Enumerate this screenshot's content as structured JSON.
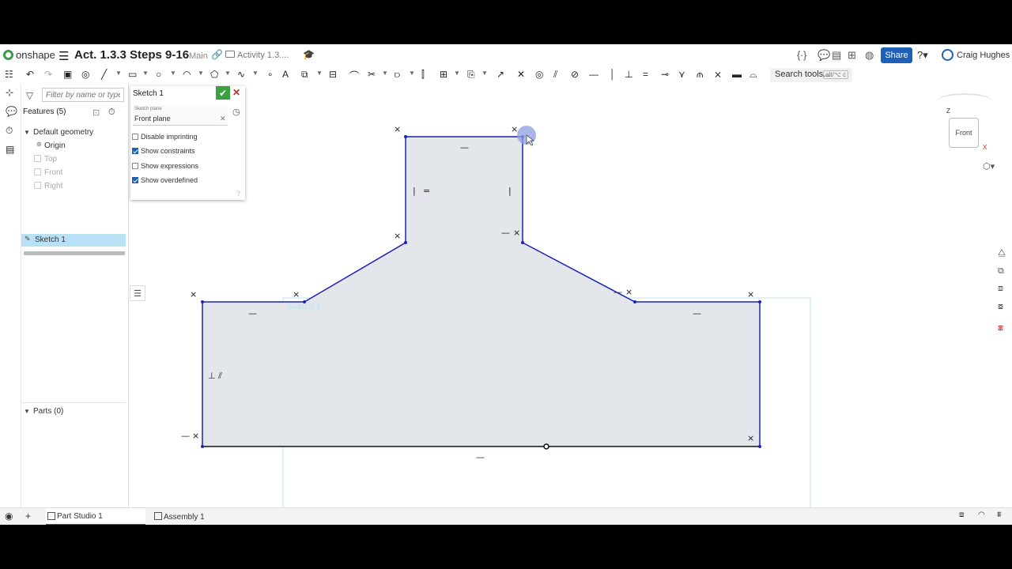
{
  "app": {
    "logo_text": "onshape",
    "doc_title": "Act. 1.3.3 Steps 9-16",
    "branch": "Main",
    "folder": "Activity 1.3....",
    "share_label": "Share",
    "user_name": "Craig Hughes"
  },
  "toolbar": {
    "search_label": "Search tools...",
    "search_shortcut": "alt/⌥ c"
  },
  "feature_panel": {
    "filter_placeholder": "Filter by name or type",
    "features_header": "Features (5)",
    "default_geometry": "Default geometry",
    "items": [
      {
        "label": "Origin"
      },
      {
        "label": "Top"
      },
      {
        "label": "Front"
      },
      {
        "label": "Right"
      },
      {
        "label": "Sketch 1"
      }
    ],
    "parts_header": "Parts (0)"
  },
  "sketch_dialog": {
    "title": "Sketch 1",
    "plane_label": "Sketch plane",
    "plane_value": "Front plane",
    "options": [
      {
        "label": "Disable imprinting",
        "checked": false
      },
      {
        "label": "Show constraints",
        "checked": true
      },
      {
        "label": "Show expressions",
        "checked": false
      },
      {
        "label": "Show overdefined",
        "checked": true
      }
    ]
  },
  "canvas": {
    "sketch_label": "Sketch 1",
    "view_cube_label": "Front",
    "axis_z": "Z",
    "axis_x": "X"
  },
  "bottom_tabs": [
    {
      "label": "Part Studio 1",
      "active": true
    },
    {
      "label": "Assembly 1",
      "active": false
    }
  ],
  "colors": {
    "accent": "#1f5fb5",
    "sketch_line": "#1a22b8",
    "sketch_fill": "#e3e6ea",
    "ok_green": "#3aa042",
    "cancel_red": "#c0281f",
    "selected_row": "#b9e1f5"
  }
}
